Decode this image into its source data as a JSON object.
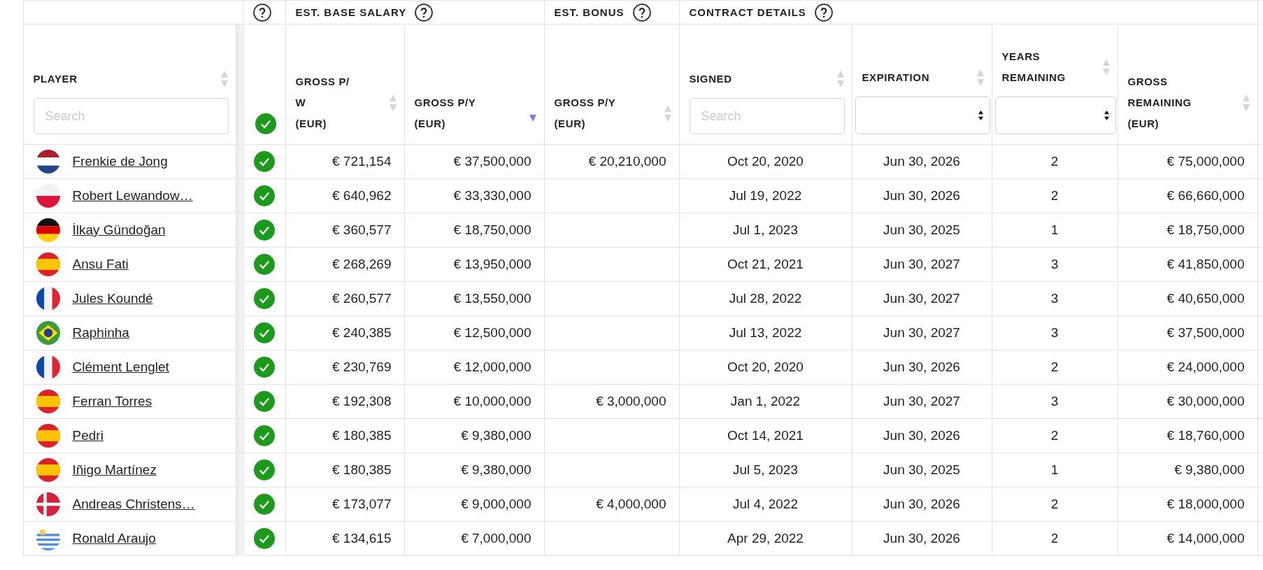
{
  "table": {
    "groups": [
      {
        "columns": [
          {
            "label": "PLAYER",
            "sort_desc": false,
            "kind": "search",
            "placeholder": "Search"
          }
        ]
      },
      {
        "help": true,
        "columns": [
          {
            "kind": "check"
          }
        ]
      },
      {
        "label": "EST. BASE SALARY",
        "help": true,
        "columns": [
          {
            "label": "GROSS P/\nW\n(EUR)",
            "sort_desc": false,
            "kind": "plain"
          },
          {
            "label": "GROSS P/Y\n(EUR)",
            "sort_desc": true,
            "kind": "plain"
          }
        ]
      },
      {
        "label": "EST. BONUS",
        "help": true,
        "columns": [
          {
            "label": "GROSS P/Y\n(EUR)",
            "sort_desc": false,
            "kind": "plain"
          }
        ]
      },
      {
        "label": "CONTRACT DETAILS",
        "help": true,
        "columns": [
          {
            "label": "SIGNED",
            "sort_desc": false,
            "kind": "search",
            "placeholder": "Search"
          },
          {
            "label": "EXPIRATION",
            "sort_desc": false,
            "kind": "select"
          },
          {
            "label": "YEARS\nREMAINING",
            "sort_desc": false,
            "kind": "select"
          },
          {
            "label": "GROSS\nREMAINING\n(EUR)",
            "sort_desc": false,
            "kind": "plain"
          }
        ]
      }
    ],
    "rows": [
      {
        "flag": {
          "kind": "nl"
        },
        "player": "Frenkie de Jong",
        "verified": true,
        "cells": [
          "€ 721,154",
          "€ 37,500,000",
          "€ 20,210,000",
          "Oct 20, 2020",
          "Jun 30, 2026",
          "2",
          "€ 75,000,000"
        ]
      },
      {
        "flag": {
          "kind": "pl"
        },
        "player": "Robert Lewandow…",
        "verified": true,
        "cells": [
          "€ 640,962",
          "€ 33,330,000",
          "",
          "Jul 19, 2022",
          "Jun 30, 2026",
          "2",
          "€ 66,660,000"
        ]
      },
      {
        "flag": {
          "kind": "de"
        },
        "player": "İlkay Gündoğan",
        "verified": true,
        "cells": [
          "€ 360,577",
          "€ 18,750,000",
          "",
          "Jul 1, 2023",
          "Jun 30, 2025",
          "1",
          "€ 18,750,000"
        ]
      },
      {
        "flag": {
          "kind": "es"
        },
        "player": "Ansu Fati",
        "verified": true,
        "cells": [
          "€ 268,269",
          "€ 13,950,000",
          "",
          "Oct 21, 2021",
          "Jun 30, 2027",
          "3",
          "€ 41,850,000"
        ]
      },
      {
        "flag": {
          "kind": "fr"
        },
        "player": "Jules Koundé",
        "verified": true,
        "cells": [
          "€ 260,577",
          "€ 13,550,000",
          "",
          "Jul 28, 2022",
          "Jun 30, 2027",
          "3",
          "€ 40,650,000"
        ]
      },
      {
        "flag": {
          "kind": "br"
        },
        "player": "Raphinha",
        "verified": true,
        "cells": [
          "€ 240,385",
          "€ 12,500,000",
          "",
          "Jul 13, 2022",
          "Jun 30, 2027",
          "3",
          "€ 37,500,000"
        ]
      },
      {
        "flag": {
          "kind": "fr"
        },
        "player": "Clément Lenglet",
        "verified": true,
        "cells": [
          "€ 230,769",
          "€ 12,000,000",
          "",
          "Oct 20, 2020",
          "Jun 30, 2026",
          "2",
          "€ 24,000,000"
        ]
      },
      {
        "flag": {
          "kind": "es"
        },
        "player": "Ferran Torres",
        "verified": true,
        "cells": [
          "€ 192,308",
          "€ 10,000,000",
          "€ 3,000,000",
          "Jan 1, 2022",
          "Jun 30, 2027",
          "3",
          "€ 30,000,000"
        ]
      },
      {
        "flag": {
          "kind": "es"
        },
        "player": "Pedri",
        "verified": true,
        "cells": [
          "€ 180,385",
          "€ 9,380,000",
          "",
          "Oct 14, 2021",
          "Jun 30, 2026",
          "2",
          "€ 18,760,000"
        ]
      },
      {
        "flag": {
          "kind": "es"
        },
        "player": "Iñigo Martínez",
        "verified": true,
        "cells": [
          "€ 180,385",
          "€ 9,380,000",
          "",
          "Jul 5, 2023",
          "Jun 30, 2025",
          "1",
          "€ 9,380,000"
        ]
      },
      {
        "flag": {
          "kind": "dk"
        },
        "player": "Andreas Christens…",
        "verified": true,
        "cells": [
          "€ 173,077",
          "€ 9,000,000",
          "€ 4,000,000",
          "Jul 4, 2022",
          "Jun 30, 2026",
          "2",
          "€ 18,000,000"
        ]
      },
      {
        "flag": {
          "kind": "uy"
        },
        "player": "Ronald Araujo",
        "verified": true,
        "cells": [
          "€ 134,615",
          "€ 7,000,000",
          "",
          "Apr 29, 2022",
          "Jun 30, 2026",
          "2",
          "€ 14,000,000"
        ]
      }
    ]
  }
}
